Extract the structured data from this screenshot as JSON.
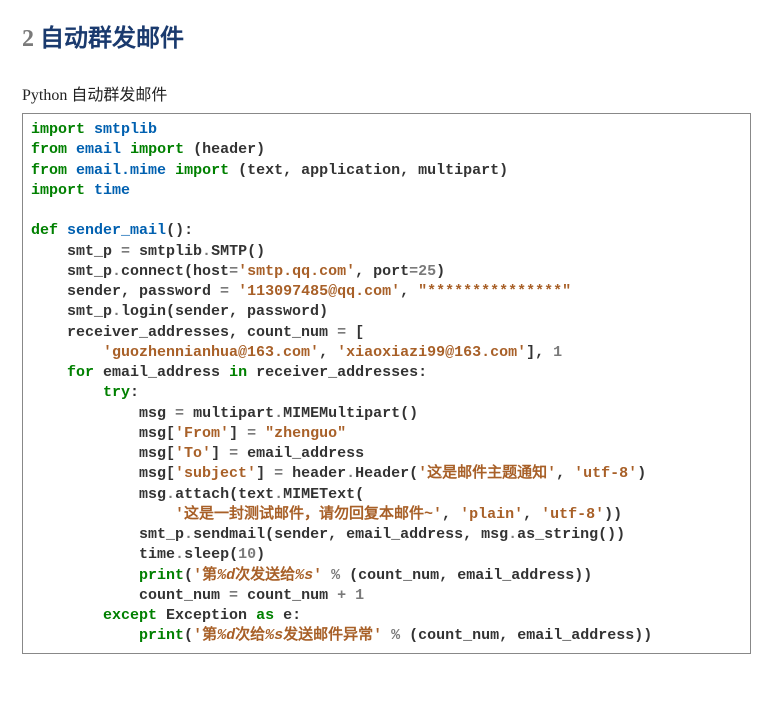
{
  "heading": {
    "number": "2",
    "title": "自动群发邮件"
  },
  "subtitle": "Python 自动群发邮件",
  "code": {
    "l1": {
      "kw1": "import",
      "mod": "smtplib"
    },
    "l2": {
      "kw1": "from",
      "mod": "email",
      "kw2": "import",
      "txt": " (header)"
    },
    "l3": {
      "kw1": "from",
      "mod": "email.mime",
      "kw2": "import",
      "txt": " (text, application, multipart)"
    },
    "l4": {
      "kw1": "import",
      "mod": "time"
    },
    "l6": {
      "kw": "def",
      "name": "sender_mail",
      "rest": "():"
    },
    "l7": {
      "a": "    smt_p ",
      "op": "=",
      "b": " smtplib",
      "dot": ".",
      "c": "SMTP()"
    },
    "l8": {
      "a": "    smt_p",
      "dot": ".",
      "b": "connect(host",
      "op": "=",
      "s1": "'smtp.qq.com'",
      "c": ", port",
      "op2": "=",
      "n": "25",
      "d": ")"
    },
    "l9": {
      "a": "    sender, password ",
      "op": "=",
      "sp": " ",
      "s1": "'113097485@qq.com'",
      "c": ", ",
      "s2": "\"***************\""
    },
    "l10": {
      "a": "    smt_p",
      "dot": ".",
      "b": "login(sender, password)"
    },
    "l11": {
      "a": "    receiver_addresses, count_num ",
      "op": "=",
      "b": " ["
    },
    "l12": {
      "pad": "        ",
      "s1": "'guozhennianhua@163.com'",
      "c": ", ",
      "s2": "'xiaoxiazi99@163.com'",
      "b": "], ",
      "n": "1"
    },
    "l13": {
      "pad": "    ",
      "kw1": "for",
      "a": " email_address ",
      "kw2": "in",
      "b": " receiver_addresses:"
    },
    "l14": {
      "pad": "        ",
      "kw": "try",
      "c": ":"
    },
    "l15": {
      "pad": "            ",
      "a": "msg ",
      "op": "=",
      "b": " multipart",
      "dot": ".",
      "c": "MIMEMultipart()"
    },
    "l16": {
      "pad": "            ",
      "a": "msg[",
      "s1": "'From'",
      "b": "] ",
      "op": "=",
      "sp": " ",
      "s2": "\"zhenguo\""
    },
    "l17": {
      "pad": "            ",
      "a": "msg[",
      "s1": "'To'",
      "b": "] ",
      "op": "=",
      "c": " email_address"
    },
    "l18": {
      "pad": "            ",
      "a": "msg[",
      "s1": "'subject'",
      "b": "] ",
      "op": "=",
      "c": " header",
      "dot": ".",
      "d": "Header(",
      "s2": "'这是邮件主题通知'",
      "e": ", ",
      "s3": "'utf-8'",
      "f": ")"
    },
    "l19": {
      "pad": "            ",
      "a": "msg",
      "dot": ".",
      "b": "attach(text",
      "dot2": ".",
      "c": "MIMEText("
    },
    "l20": {
      "pad": "                ",
      "s1": "'这是一封测试邮件，请勿回复本邮件~'",
      "a": ", ",
      "s2": "'plain'",
      "b": ", ",
      "s3": "'utf-8'",
      "c": "))"
    },
    "l21": {
      "pad": "            ",
      "a": "smt_p",
      "dot": ".",
      "b": "sendmail(sender, email_address, msg",
      "dot2": ".",
      "c": "as_string())"
    },
    "l22": {
      "pad": "            ",
      "a": "time",
      "dot": ".",
      "b": "sleep(",
      "n": "10",
      "c": ")"
    },
    "l23": {
      "pad": "            ",
      "fn": "print",
      "a": "(",
      "s1": "'第",
      "i1": "%d",
      "s2": "次发送给",
      "i2": "%s",
      "s3": "'",
      "b": " ",
      "op": "%",
      "c": " (count_num, email_address))"
    },
    "l24": {
      "pad": "            ",
      "a": "count_num ",
      "op": "=",
      "b": " count_num ",
      "op2": "+",
      "sp": " ",
      "n": "1"
    },
    "l25": {
      "pad": "        ",
      "kw1": "except",
      "a": " Exception ",
      "kw2": "as",
      "b": " e:"
    },
    "l26": {
      "pad": "            ",
      "fn": "print",
      "a": "(",
      "s1": "'第",
      "i1": "%d",
      "s2": "次给",
      "i2": "%s",
      "s3": "发送邮件异常'",
      "b": " ",
      "op": "%",
      "c": " (count_num, email_address))"
    }
  }
}
